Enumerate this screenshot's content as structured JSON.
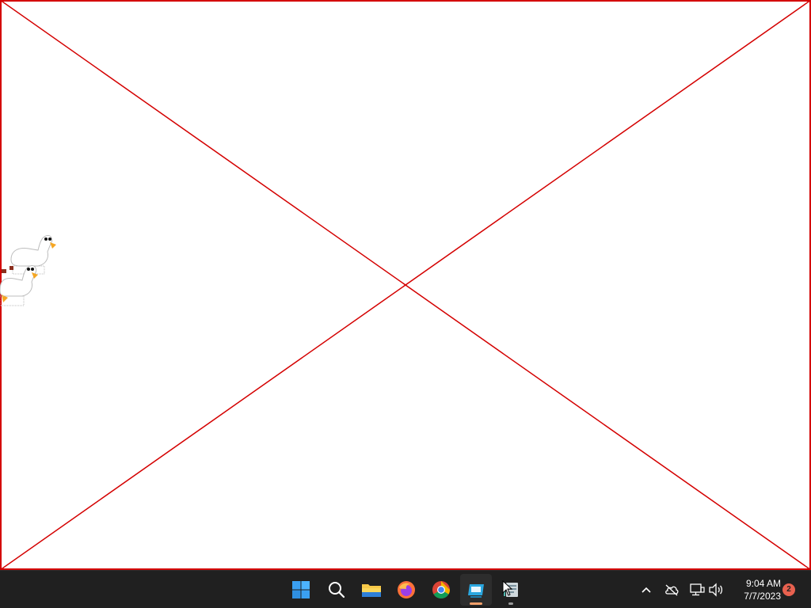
{
  "desktop": {
    "background": "#ffffff",
    "placeholder_cross_color": "#d40000"
  },
  "overlay_pets": [
    {
      "name": "goose",
      "description_icon": "goose-icon"
    },
    {
      "name": "goose",
      "description_icon": "goose-icon"
    }
  ],
  "taskbar": {
    "background": "#202020",
    "pinned_apps": [
      {
        "name": "start",
        "icon": "windows-start-icon"
      },
      {
        "name": "search",
        "icon": "search-icon"
      },
      {
        "name": "file-explorer",
        "icon": "folder-icon"
      },
      {
        "name": "firefox",
        "icon": "firefox-icon"
      },
      {
        "name": "chrome",
        "icon": "chrome-icon"
      },
      {
        "name": "active-app",
        "icon": "window-app-icon",
        "active": true
      },
      {
        "name": "notepad-app",
        "icon": "notepad-icon",
        "running": true
      }
    ],
    "tray": {
      "icons": [
        "chevron-up-icon",
        "cloud-offline-icon",
        "network-icon",
        "volume-icon"
      ],
      "time": "9:04 AM",
      "date": "7/7/2023",
      "notification_count": "2",
      "accent": "#e8614f"
    }
  }
}
